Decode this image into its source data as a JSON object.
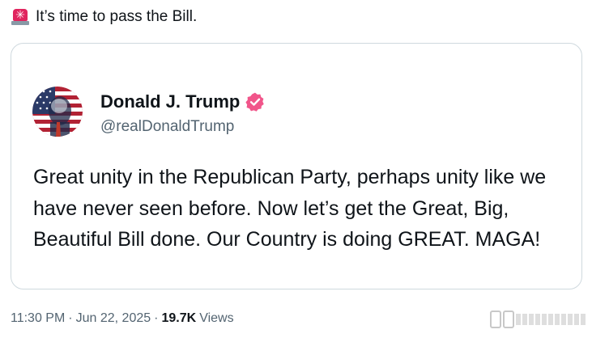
{
  "post": {
    "icon": "police-light-emoji",
    "text": "It’s time to pass the Bill."
  },
  "quoted_post": {
    "author": {
      "name": "Donald J. Trump",
      "handle": "@realDonaldTrump",
      "verified_color": "#f1558a"
    },
    "body": "Great unity in the Republican Party, perhaps unity like we have never seen before. Now let’s get the Great, Big, Beautiful Bill done. Our Country is doing GREAT. MAGA!"
  },
  "meta": {
    "time": "11:30 PM",
    "separator": "·",
    "date": "Jun 22, 2025",
    "views_count": "19.7K",
    "views_label": "Views"
  },
  "colors": {
    "text_primary": "#0f1419",
    "text_secondary": "#536471",
    "card_border": "#cfd9de"
  }
}
